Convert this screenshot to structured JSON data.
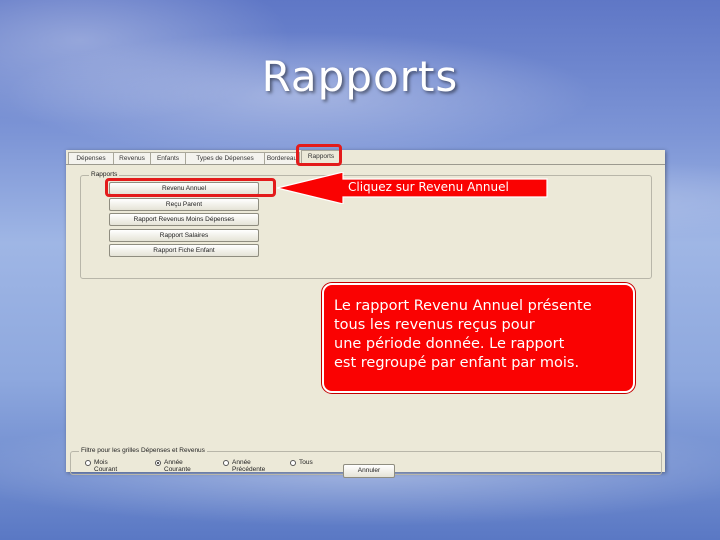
{
  "slide": {
    "title": "Rapports"
  },
  "app": {
    "tabs": [
      {
        "label": "Dépenses"
      },
      {
        "label": "Revenus"
      },
      {
        "label": "Enfants"
      },
      {
        "label": "Types de Dépenses"
      },
      {
        "label": "Bordereau"
      },
      {
        "label": "Rapports"
      }
    ],
    "active_tab": "Rapports",
    "reports_group": {
      "title": "Rapports",
      "buttons": [
        {
          "label": "Revenu Annuel"
        },
        {
          "label": "Reçu Parent"
        },
        {
          "label": "Rapport Revenus Moins Dépenses"
        },
        {
          "label": "Rapport Salaires"
        },
        {
          "label": "Rapport Fiche Enfant"
        }
      ]
    },
    "filter": {
      "title": "Filtre pour les grilles Dépenses et Revenus",
      "options": [
        {
          "line1": "Mois",
          "line2": "Courant",
          "selected": false
        },
        {
          "line1": "Année",
          "line2": "Courante",
          "selected": true
        },
        {
          "line1": "Année",
          "line2": "Précédente",
          "selected": false
        },
        {
          "line1": "Tous",
          "line2": "",
          "selected": false
        }
      ],
      "button_label": "Annuler"
    }
  },
  "callout": {
    "arrow_text": "Cliquez sur Revenu Annuel",
    "info_lines": [
      "Le rapport Revenu Annuel présente",
      "tous les revenus reçus pour",
      "une période donnée. Le rapport",
      "est regroupé par enfant par mois."
    ]
  },
  "colors": {
    "highlight": "#e31b1b",
    "callout_fill": "#fa0202",
    "window_bg": "#ece9d8"
  }
}
